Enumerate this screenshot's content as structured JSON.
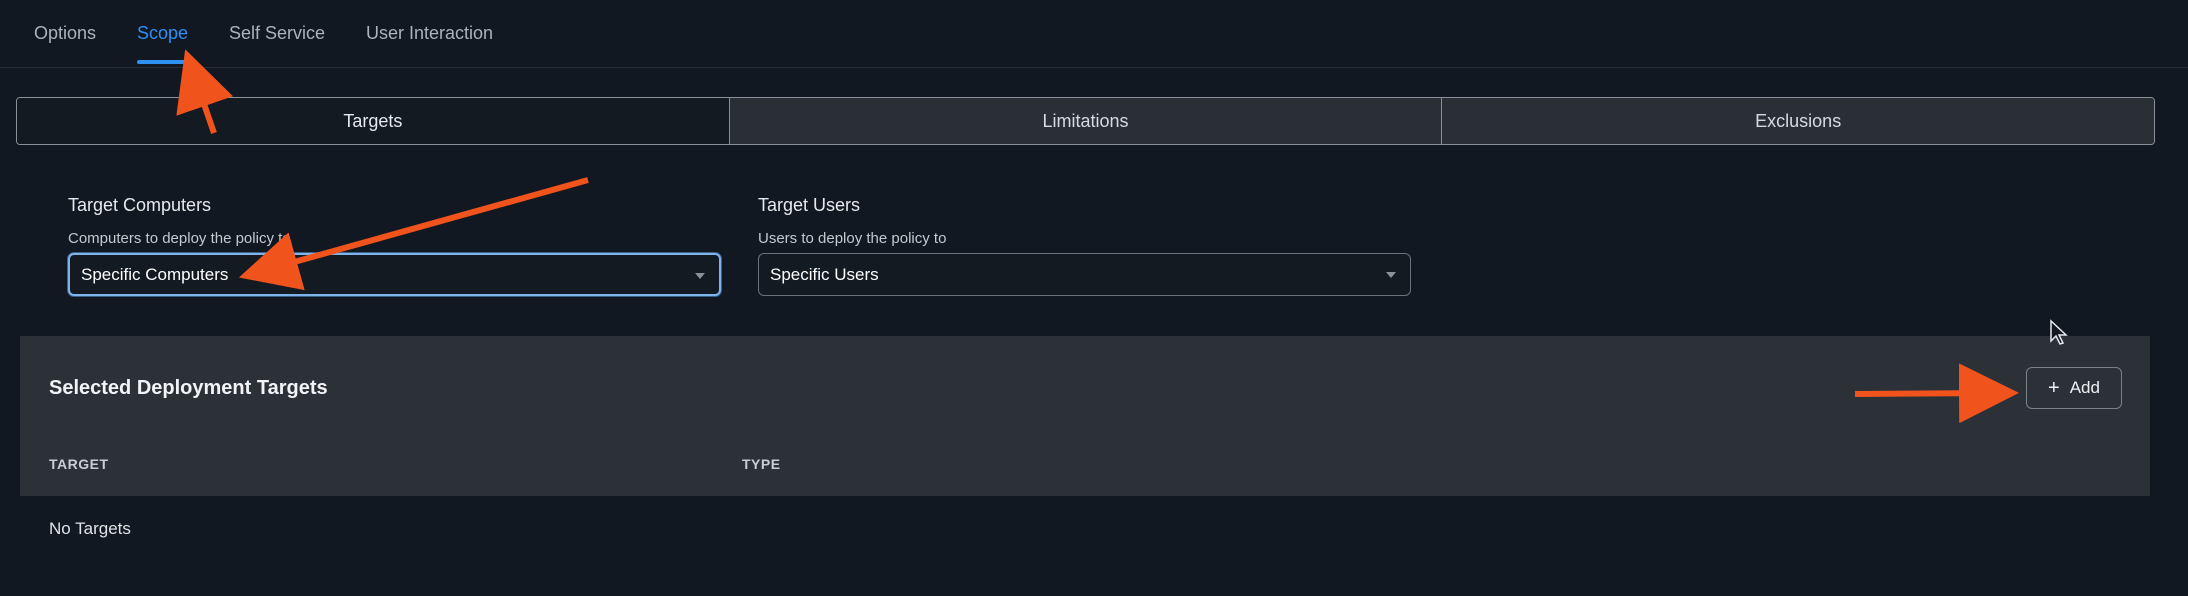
{
  "top_tabs": {
    "items": [
      {
        "label": "Options"
      },
      {
        "label": "Scope"
      },
      {
        "label": "Self Service"
      },
      {
        "label": "User Interaction"
      }
    ],
    "active": "Scope"
  },
  "segments": {
    "items": [
      {
        "label": "Targets"
      },
      {
        "label": "Limitations"
      },
      {
        "label": "Exclusions"
      }
    ],
    "selected": "Targets"
  },
  "target_computers": {
    "label": "Target Computers",
    "help": "Computers to deploy the policy to",
    "value": "Specific Computers"
  },
  "target_users": {
    "label": "Target Users",
    "help": "Users to deploy the policy to",
    "value": "Specific Users"
  },
  "deployment_targets": {
    "title": "Selected Deployment Targets",
    "add_label": "Add",
    "columns": [
      "TARGET",
      "TYPE"
    ],
    "empty_text": "No Targets"
  },
  "colors": {
    "background": "#121821",
    "accent": "#2f8ff2",
    "annotation_arrow": "#f0531c",
    "panel": "#2c3037"
  },
  "icons": {
    "add": "plus-icon",
    "dropdown": "chevron-down-icon",
    "cursor": "mouse-pointer-icon",
    "annotation": "arrow-icon"
  }
}
